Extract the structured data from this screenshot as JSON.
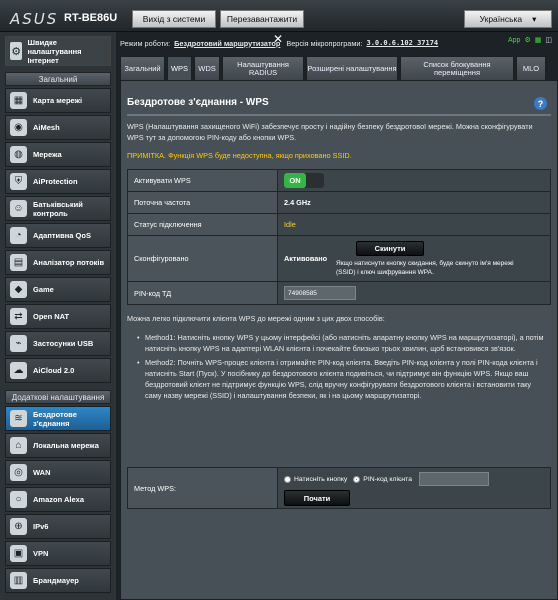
{
  "header": {
    "logo": "ASUS",
    "model": "RT-BE86U",
    "logout_label": "Вихід з системи",
    "reboot_label": "Перезавантажити",
    "language": "Українська"
  },
  "sidebar": {
    "quick_setup": "Швидке налаштування Інтернет",
    "general_title": "Загальний",
    "general_items": [
      {
        "label": "Карта мережі",
        "icon": "network-map-icon"
      },
      {
        "label": "AiMesh",
        "icon": "aimesh-icon"
      },
      {
        "label": "Мережа",
        "icon": "guest-network-icon"
      },
      {
        "label": "AiProtection",
        "icon": "aiprotection-icon"
      },
      {
        "label": "Батьківський контроль",
        "icon": "parental-control-icon"
      },
      {
        "label": "Адаптивна QoS",
        "icon": "qos-icon"
      },
      {
        "label": "Аналізатор потоків",
        "icon": "traffic-analyzer-icon"
      },
      {
        "label": "Game",
        "icon": "game-icon"
      },
      {
        "label": "Open NAT",
        "icon": "open-nat-icon"
      },
      {
        "label": "Застосунки USB",
        "icon": "usb-icon"
      },
      {
        "label": "AiCloud 2.0",
        "icon": "aicloud-icon"
      }
    ],
    "advanced_title": "Додаткові налаштування",
    "advanced_items": [
      {
        "label": "Бездротове з'єднання",
        "icon": "wireless-icon",
        "active": true
      },
      {
        "label": "Локальна мережа",
        "icon": "lan-icon"
      },
      {
        "label": "WAN",
        "icon": "wan-icon"
      },
      {
        "label": "Amazon Alexa",
        "icon": "alexa-icon"
      },
      {
        "label": "IPv6",
        "icon": "ipv6-icon"
      },
      {
        "label": "VPN",
        "icon": "vpn-icon"
      },
      {
        "label": "Брандмауер",
        "icon": "firewall-icon"
      }
    ]
  },
  "status": {
    "mode_label": "Режим роботи:",
    "mode_value": "Бездротовий маршрутизатор",
    "fw_label": "Версія мікропрограми:",
    "fw_value": "3.0.0.6.102_37174",
    "app_label": "App"
  },
  "tabs": [
    {
      "label": "Загальний"
    },
    {
      "label": "WPS",
      "active": true
    },
    {
      "label": "WDS"
    },
    {
      "label": "Налаштування RADIUS"
    },
    {
      "label": "Розширені налаштування"
    },
    {
      "label": "Список блокування переміщення"
    },
    {
      "label": "MLO"
    }
  ],
  "panel": {
    "title": "Бездротове з'єднання - WPS",
    "description": "WPS (Налаштування захищеного WiFi) забезпечує просту і надійну безпеку бездротової мережі. Можна сконфігурувати WPS тут за допомогою PIN-коду або кнопки WPS.",
    "note": "ПРИМІТКА. Функція WPS буде недоступна, якщо приховано SSID.",
    "rows": {
      "enable_label": "Активувати WPS",
      "enable_value": "ON",
      "freq_label": "Поточна частота",
      "freq_value": "2.4 GHz",
      "conn_label": "Статус підключення",
      "conn_value": "Idle",
      "config_label": "Сконфігуровано",
      "config_value": "Активовано",
      "reset_button": "Скинути",
      "reset_hint": "Якщо натиснути кнопку скидання, буде скинуто ім'я мережі (SSID) і ключ шифрування WPA.",
      "pin_label": "PIN-код ТД",
      "pin_value": "74908585"
    },
    "methods_intro": "Можна легко підключити клієнта WPS до мережі одним з цих двох способів:",
    "method1": "Method1: Натисніть кнопку WPS у цьому інтерфейсі (або натисніть апаратну кнопку WPS на маршрутизаторі), а потім натисніть кнопку WPS на адаптері WLAN клієнта і почекайте близько трьох хвилин, щоб встановився зв'язок.",
    "method2": "Method2: Почніть WPS-процес клієнта і отримайте PIN-код клієнта. Введіть PIN-код клієнта у полі PIN-кода клієнта і натисніть Start (Пуск). У посібнику до бездротового клієнта подивіться, чи підтримує він функцію WPS. Якщо ваш бездротовий клієнт не підтримує функцію WPS, слід вручну конфігурувати бездротового клієнта і встановити таку саму назву мережі (SSID) і налаштування безпеки, як і на цьому маршрутизаторі.",
    "wps_method_label": "Метод WPS:",
    "opt_push": "Натисніть кнопку",
    "opt_pin": "PIN-код клієнта",
    "pin_input_value": "",
    "start_button": "Почати"
  }
}
